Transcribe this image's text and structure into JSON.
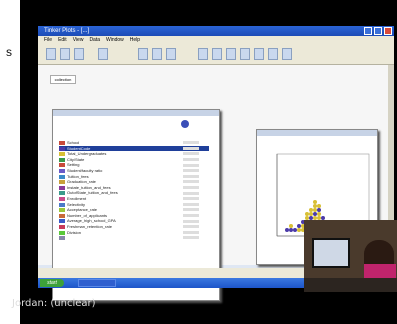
{
  "caption": "Jordan: (unclear)",
  "colors": {
    "accent": "#1f3f9a",
    "point_purple": "#4b3aa8",
    "point_yellow": "#d8c035"
  },
  "window": {
    "title": "Tinker Plots - [...]",
    "menu": [
      "File",
      "Edit",
      "View",
      "Data",
      "Window",
      "Help"
    ]
  },
  "attribute_window": {
    "tab": "collection",
    "attributes": [
      {
        "name": "School",
        "value": "",
        "color": "#c84a3a",
        "selected": false
      },
      {
        "name": "StudentCode",
        "value": "",
        "color": "#4b3aa8",
        "selected": true
      },
      {
        "name": "Total_Undergraduates",
        "value": "",
        "color": "#d8c035",
        "selected": false
      },
      {
        "name": "City/State",
        "value": "",
        "color": "#3a9a4a",
        "selected": false
      },
      {
        "name": "Setting",
        "value": "",
        "color": "#c84a3a",
        "selected": false
      },
      {
        "name": "Student/faculty ratio",
        "value": "",
        "color": "#6a5ac8",
        "selected": false
      },
      {
        "name": "Tuition_fees",
        "value": "",
        "color": "#3a8ac8",
        "selected": false
      },
      {
        "name": "Graduation_rate",
        "value": "",
        "color": "#c8a03a",
        "selected": false
      },
      {
        "name": "Instate_tuition_and_fees",
        "value": "",
        "color": "#8a3a9a",
        "selected": false
      },
      {
        "name": "OutofState_tuition_and_fees",
        "value": "",
        "color": "#3a9a8a",
        "selected": false
      },
      {
        "name": "Enrollment",
        "value": "",
        "color": "#c84a8a",
        "selected": false
      },
      {
        "name": "Selectivity",
        "value": "",
        "color": "#4a7ac8",
        "selected": false
      },
      {
        "name": "Acceptance_rate",
        "value": "",
        "color": "#9ac83a",
        "selected": false
      },
      {
        "name": "Number_of_applicants",
        "value": "",
        "color": "#c86a3a",
        "selected": false
      },
      {
        "name": "Average_high_school_GPA",
        "value": "",
        "color": "#3a5ac8",
        "selected": false
      },
      {
        "name": "Freshman_retention_rate",
        "value": "",
        "color": "#c83a5a",
        "selected": false
      },
      {
        "name": "Division",
        "value": "",
        "color": "#5ac83a",
        "selected": false
      },
      {
        "name": "",
        "value": "",
        "color": "#8888aa",
        "selected": false
      }
    ]
  },
  "plot": {
    "x_label": "",
    "y_label": ""
  },
  "taskbar": {
    "start": "start"
  }
}
